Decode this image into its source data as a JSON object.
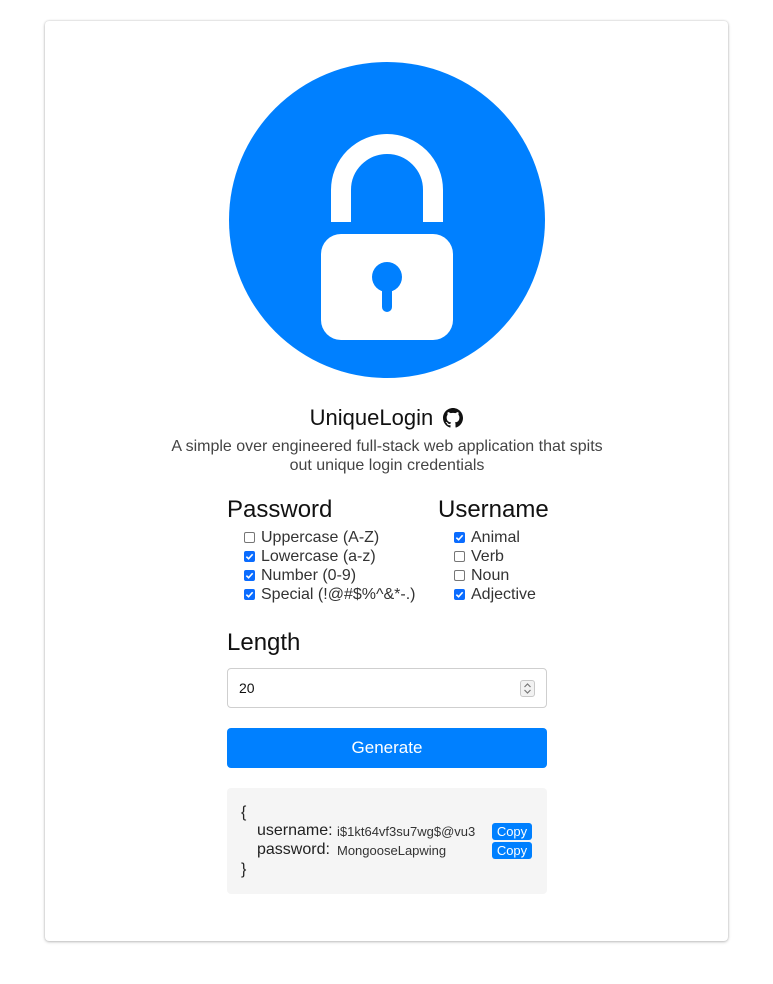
{
  "app": {
    "title": "UniqueLogin",
    "subtitle": "A simple over engineered full-stack web application that spits out unique login credentials",
    "logo_icon": "lock-icon",
    "github_icon": "github-icon",
    "accent_color": "#0080ff"
  },
  "password": {
    "heading": "Password",
    "options": [
      {
        "label": "Uppercase (A-Z)",
        "checked": false
      },
      {
        "label": "Lowercase (a-z)",
        "checked": true
      },
      {
        "label": "Number (0-9)",
        "checked": true
      },
      {
        "label": "Special (!@#$%^&*-.)",
        "checked": true
      }
    ]
  },
  "username": {
    "heading": "Username",
    "options": [
      {
        "label": "Animal",
        "checked": true
      },
      {
        "label": "Verb",
        "checked": false
      },
      {
        "label": "Noun",
        "checked": false
      },
      {
        "label": "Adjective",
        "checked": true
      }
    ]
  },
  "length": {
    "heading": "Length",
    "value": "20"
  },
  "generate": {
    "label": "Generate"
  },
  "result": {
    "open_brace": "{",
    "close_brace": "}",
    "username_key": "username:",
    "username_value": "i$1kt64vf3su7wg$@vu3",
    "password_key": "password:",
    "password_value": "MongooseLapwing",
    "copy_label": "Copy"
  }
}
